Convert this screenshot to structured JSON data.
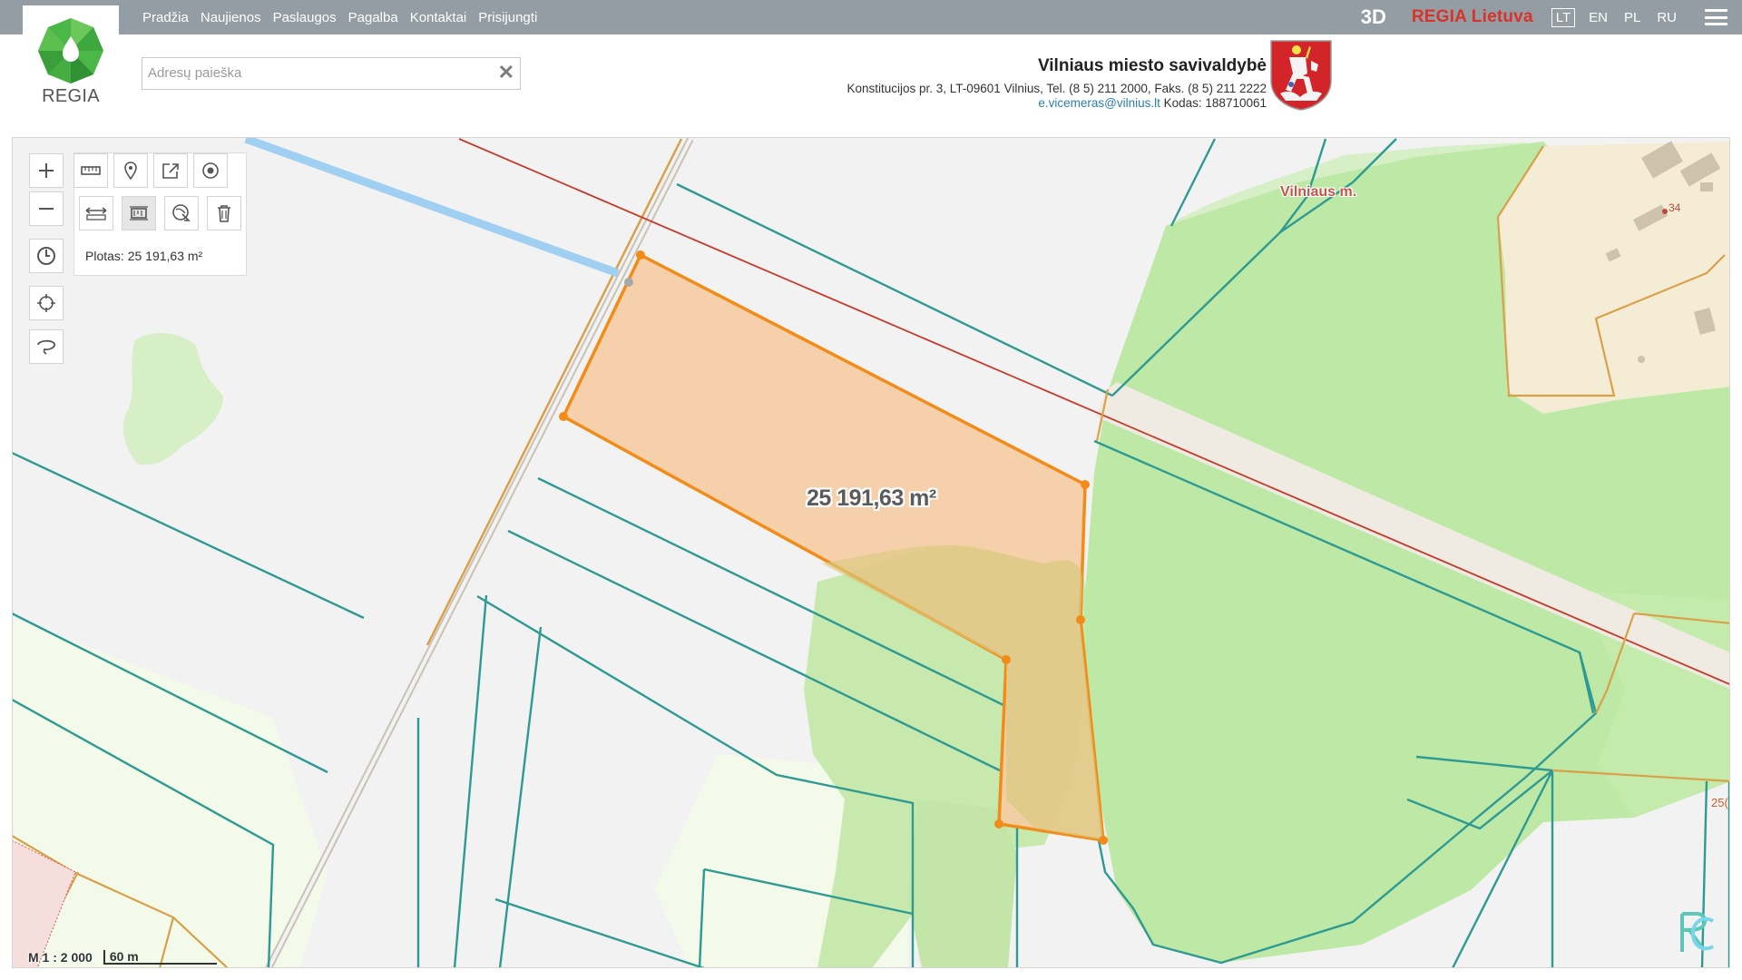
{
  "nav": {
    "items": [
      "Pradžia",
      "Naujienos",
      "Paslaugos",
      "Pagalba",
      "Kontaktai",
      "Prisijungti"
    ]
  },
  "topright": {
    "btn_3d": "3D",
    "regia_country": "REGIA Lietuva",
    "languages": [
      "LT",
      "EN",
      "PL",
      "RU"
    ],
    "active_language": "LT"
  },
  "logo": {
    "text": "REGIA"
  },
  "search": {
    "placeholder": "Adresų paieška",
    "value": ""
  },
  "municipality": {
    "name": "Vilniaus miesto savivaldybė",
    "address": "Konstitucijos pr. 3, LT-09601 Vilnius, Tel. (8 5) 211 2000, Faks. (8 5) 211 2222",
    "email": "e.vicemeras@vilnius.lt",
    "code": "Kodas: 188710061"
  },
  "map": {
    "measurement": {
      "label": "Plotas:",
      "value": "25 191,63 m²",
      "overlay_label": "25 191,63 m²"
    },
    "place_label": "Vilniaus m.",
    "house_number": "34",
    "edge_number": "25(",
    "scale": {
      "ratio": "M 1 : 2 000",
      "length": "60 m"
    },
    "colors": {
      "background": "#f2f2f2",
      "forest": "#bde8a5",
      "forest_light": "#d7efc6",
      "parcel_line": "#2e9a92",
      "measure_stroke": "#f28b18",
      "measure_fill": "#f6cba0",
      "road": "#d9a04a",
      "water": "#9fd0f2",
      "boundary_red": "#c43a2a",
      "residential": "#f5ecd6"
    }
  },
  "icons": {
    "toolbar": [
      "zoom-in-icon",
      "ruler-icon",
      "marker-icon",
      "export-icon",
      "target-icon",
      "zoom-out-icon",
      "measure-distance-icon",
      "measure-area-icon",
      "clear-measure-icon",
      "trash-icon",
      "history-icon",
      "locate-icon",
      "lasso-icon"
    ]
  }
}
